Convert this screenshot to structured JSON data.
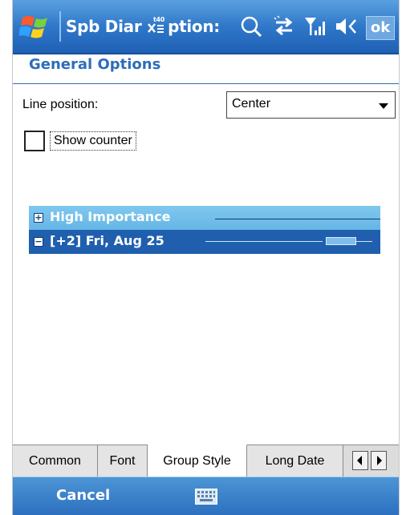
{
  "titlebar": {
    "title": "Spb Diar",
    "title_suffix": "ption:",
    "ok_label": "ok",
    "icons": [
      "windows-start-icon",
      "input-panel-icon",
      "search-icon",
      "connectivity-icon",
      "signal-icon",
      "volume-icon"
    ]
  },
  "header": {
    "title": "General Options"
  },
  "options": {
    "line_position_label": "Line position:",
    "line_position_value": "Center",
    "show_counter_label": "Show counter",
    "show_counter_checked": false
  },
  "preview": {
    "row1": {
      "symbol": "+",
      "text": "High Importance"
    },
    "row2": {
      "symbol": "−",
      "text": "[+2] Fri, Aug 25"
    }
  },
  "tabs": [
    {
      "label": "Common",
      "active": false
    },
    {
      "label": "Font",
      "active": false
    },
    {
      "label": "Group Style",
      "active": true
    },
    {
      "label": "Long Date",
      "active": false
    }
  ],
  "bottombar": {
    "cancel_label": "Cancel"
  },
  "colors": {
    "accent": "#2d6db8",
    "titlebar": "#2f78c9",
    "preview_dark": "#1f5fae",
    "preview_light": "#7fc8ef"
  }
}
